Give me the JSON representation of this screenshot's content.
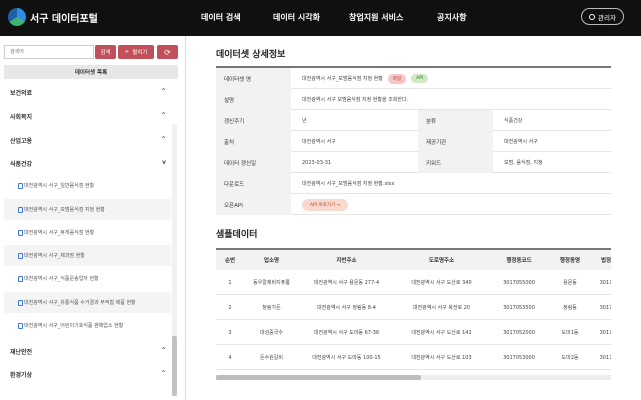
{
  "header": {
    "site_title": "서구 데이터포털",
    "nav": [
      "데이터 검색",
      "데이터 시각화",
      "창업지원 서비스",
      "공지사항"
    ],
    "admin_label": "관리자"
  },
  "sidebar": {
    "search_placeholder": "검색어",
    "search_button": "검색",
    "expand_button": "펼치기",
    "list_title": "데이터셋 목록",
    "categories_top": [
      {
        "label": "보건의료",
        "chevron": "^"
      },
      {
        "label": "사회복지",
        "chevron": "^"
      },
      {
        "label": "산업고용",
        "chevron": "^"
      },
      {
        "label": "식품건강",
        "chevron": "v"
      }
    ],
    "items": [
      "대전광역시 서구_일반음식점 현황",
      "대전광역시 서구_모범음식점 지정 현황",
      "대전광역시 서구_휴게음식점 현황",
      "대전광역시 서구_제과점 현황",
      "대전광역시 서구_식품운송업자 현황",
      "대전광역시 서구_유통식품 수거결과 부적합 제품 현황",
      "대전광역시 서구_어린이기호식품 판매업소 현황"
    ],
    "categories_bottom": [
      {
        "label": "재난안전",
        "chevron": "^"
      },
      {
        "label": "환경기상",
        "chevron": "^"
      }
    ]
  },
  "detail": {
    "title": "데이터셋 상세정보",
    "name_label": "데이터셋 명",
    "name_value": "대전광역시 서구_모범음식점 지정 현황",
    "badge_file": "파일",
    "badge_api": "API",
    "desc_label": "설명",
    "desc_value": "대전광역시 서구 모범음식점 지정 현황을 조회한다.",
    "cycle_label": "갱신주기",
    "cycle_value": "년",
    "category_label": "분류",
    "category_value": "식품건강",
    "source_label": "출처",
    "source_value": "대전광역시 서구",
    "provider_label": "제공기관",
    "provider_value": "대전광역시 서구",
    "updated_label": "데이터 갱신일",
    "updated_value": "2023-03-31",
    "keyword_label": "키워드",
    "keyword_value": "모범, 음식점, 지정",
    "download_label": "다운로드",
    "download_value": "대전광역시 서구_모범음식점 지정 현황.xlsx",
    "openapi_label": "오픈API",
    "openapi_button": "API 바로가기 →"
  },
  "sample": {
    "title": "샘플데이터",
    "columns": [
      "순번",
      "업소명",
      "지번주소",
      "도로명주소",
      "행정동코드",
      "행정동명",
      "법정"
    ],
    "rows": [
      [
        "1",
        "동우칼제비지퓨롬",
        "대전광역시 서구 용문동 277-4",
        "대전광역시 서구 도산로 340",
        "3017055000",
        "용문동",
        "3017"
      ],
      [
        "2",
        "청림가든",
        "대전광역시 서구 정림동 8-4",
        "대전광역시 서구 복전로 20",
        "3017053500",
        "정림동",
        "3017"
      ],
      [
        "3",
        "대성중국수",
        "대전광역시 서구 도마동 67-36",
        "대전광역시 서구 도산로 141",
        "3017052000",
        "도마1동",
        "3017"
      ],
      [
        "4",
        "돈수원갈비",
        "대전광역시 서구 도마동 100-15",
        "대전광역시 서구 도산로 103",
        "3017053000",
        "도마2동",
        "3017"
      ]
    ]
  },
  "colors": {
    "topbar": "#101010",
    "accent_red": "#c0505a",
    "badge_file": "#f6c6c6",
    "badge_api": "#cfe8c6"
  }
}
